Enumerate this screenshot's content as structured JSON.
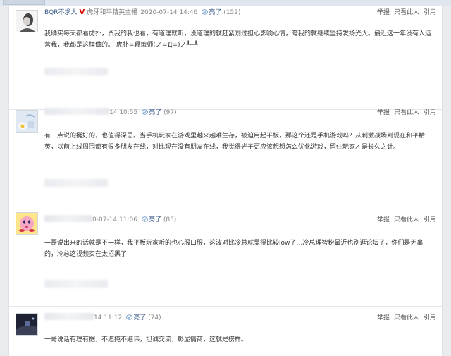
{
  "posts": [
    {
      "author": "BQR不求人",
      "vip": "V",
      "title": "虎牙和平精英主播",
      "time": "2020-07-14 14:46",
      "like_label": "亮了",
      "like_count": "(152)",
      "actions": [
        "举报",
        "只看此人",
        "引用"
      ],
      "content": "我确实每天都看虎扑，贸我的我也看，有道理就听，没道理的就赶紧划过担心影响心情，夸我的就继续坚持发扬光大。最近这一年没有人运营我，我都是这样做的。 虎扑=鞭策师(ノ=Д=)ノ┻━┻"
    },
    {
      "time": "14 10:55",
      "like_label": "亮了",
      "like_count": "(97)",
      "actions": [
        "举报",
        "只看此人",
        "引用"
      ],
      "content": "有一点说的挺好的，也值得深思。当手机玩家在游戏里越来越难生存，被迫用起平板，那这个还是手机游戏吗？从刺激战场到现在和平精英，以前上线周围都有很多朋友在线，对比现在没有朋友在线，我觉得光子更应该想想怎么优化游戏，留住玩家才是长久之计。"
    },
    {
      "time": "0-07-14 11:06",
      "like_label": "亮了",
      "like_count": "(83)",
      "actions": [
        "举报",
        "只看此人",
        "引用"
      ],
      "content": "一哥说出来的话就是不一样，我平板玩家听的也心服口服，这波对比冷总就显得比较low了…冷总理智粉最近也别逛论坛了，你们是无辜的，冷总这视频实在太招黑了"
    },
    {
      "time": "14 11:12",
      "like_label": "亮了",
      "like_count": "(74)",
      "actions": [
        "举报",
        "只看此人",
        "引用"
      ],
      "content": "一哥说话有理有据，不遮掩不避讳，坦诚交流，彰显情商，这就是榜样。"
    }
  ],
  "colors": {
    "link": "#3b5d8c",
    "vip": "#d60000",
    "text": "#333333",
    "meta": "#888888"
  }
}
